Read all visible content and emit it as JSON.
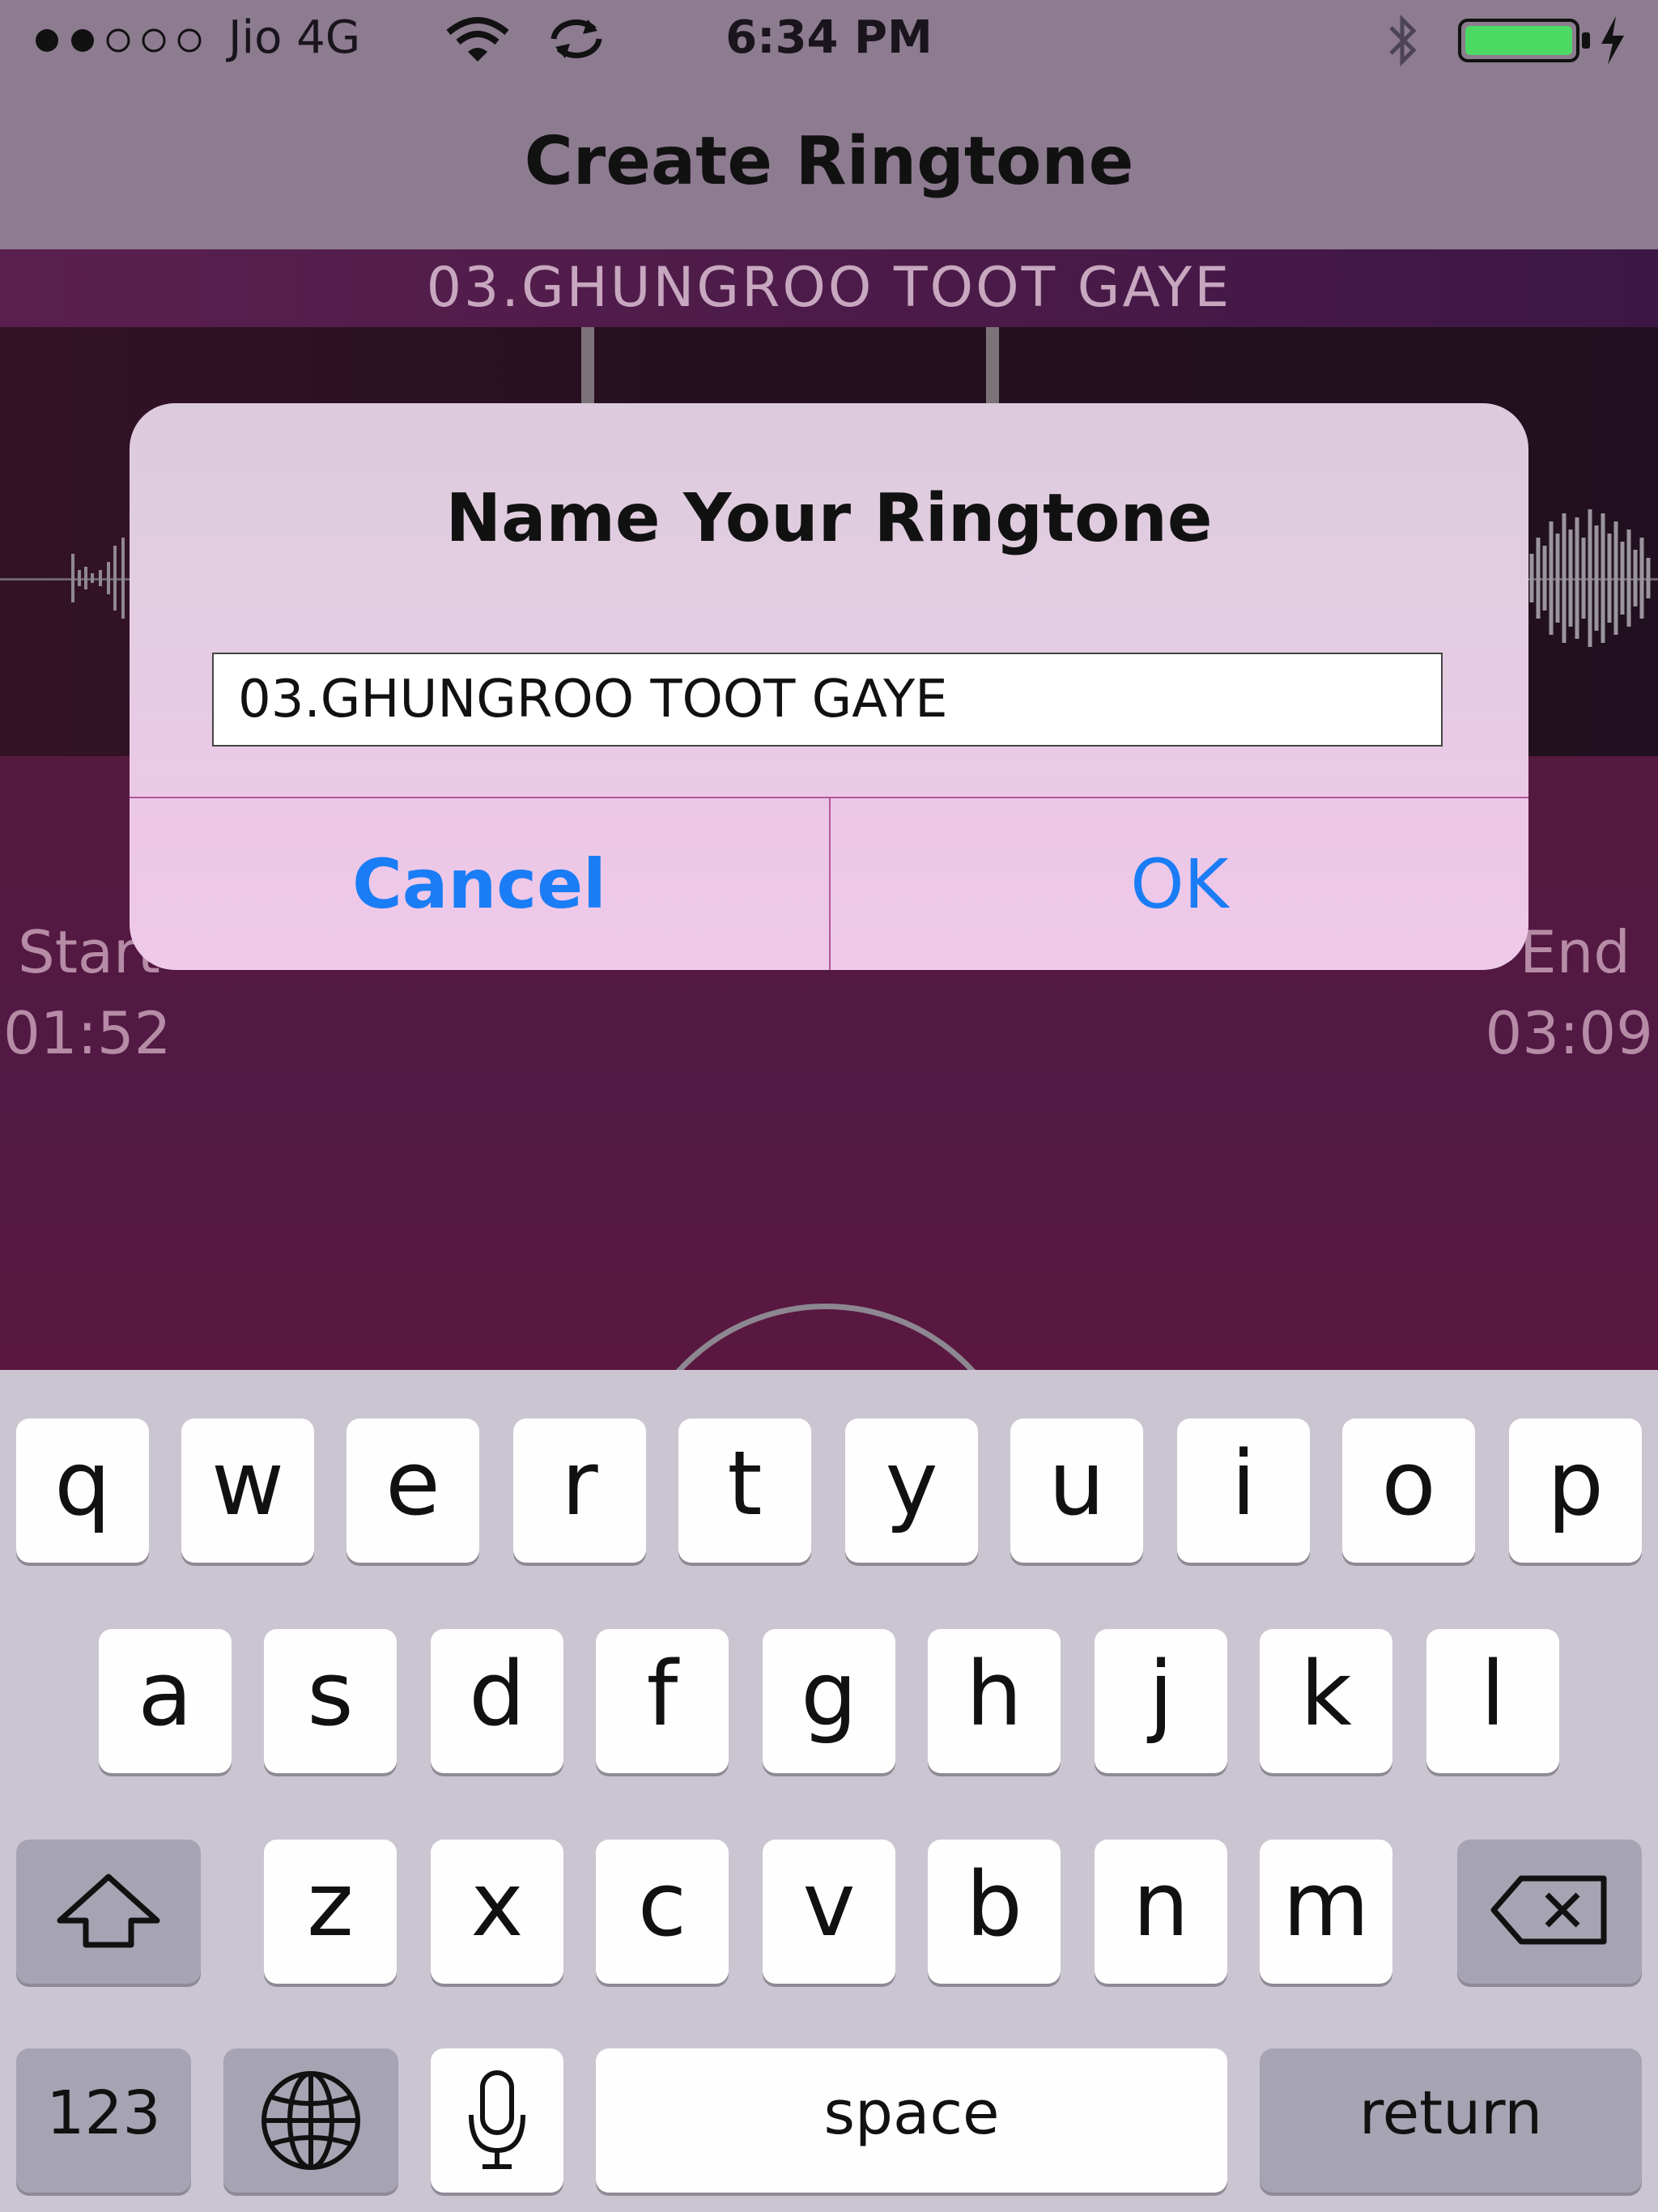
{
  "status_bar": {
    "carrier": "Jio 4G",
    "time": "6:34 PM",
    "signal_dots": 5,
    "signal_filled": 2,
    "battery_level": 1.0
  },
  "nav": {
    "title": "Create Ringtone"
  },
  "song": {
    "title": "03.GHUNGROO TOOT GAYE"
  },
  "trim": {
    "start_label": "Start",
    "start_time": "01:52",
    "end_label": "End",
    "end_time": "03:09"
  },
  "alert": {
    "title": "Name Your Ringtone",
    "input_value": "03.GHUNGROO TOOT GAYE",
    "cancel": "Cancel",
    "ok": "OK"
  },
  "keyboard": {
    "row1": [
      "q",
      "w",
      "e",
      "r",
      "t",
      "y",
      "u",
      "i",
      "o",
      "p"
    ],
    "row2": [
      "a",
      "s",
      "d",
      "f",
      "g",
      "h",
      "j",
      "k",
      "l"
    ],
    "row3": [
      "z",
      "x",
      "c",
      "v",
      "b",
      "n",
      "m"
    ],
    "numbers": "123",
    "space": "space",
    "return": "return"
  },
  "colors": {
    "accent_blue": "#1a7df6",
    "battery_green": "#4cd964",
    "background_purple": "#4f1a3f"
  }
}
